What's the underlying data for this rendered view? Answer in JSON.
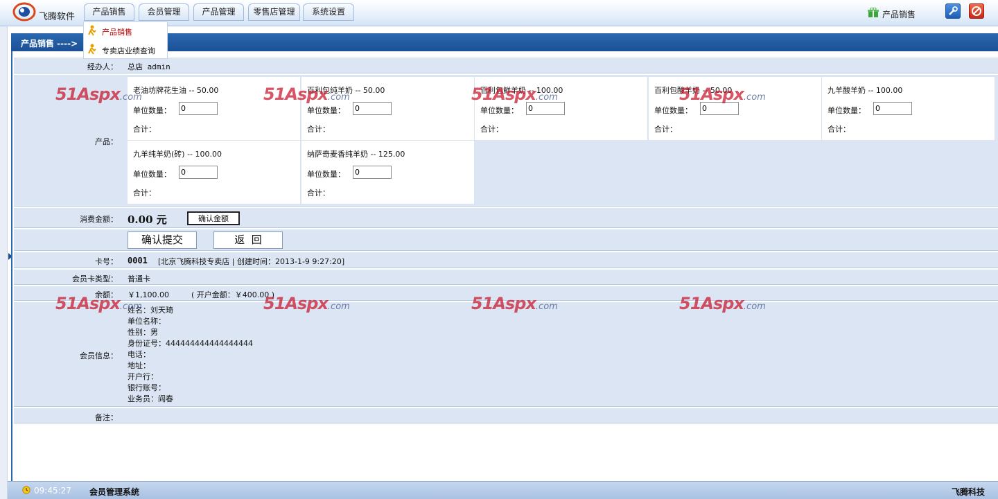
{
  "header": {
    "brand": "飞腾软件",
    "nav": [
      "产品销售",
      "会员管理",
      "产品管理",
      "零售店管理",
      "系统设置"
    ],
    "right_label": "产品销售"
  },
  "dropdown": {
    "items": [
      "产品销售",
      "专卖店业绩查询"
    ]
  },
  "title": "产品销售 ---->",
  "form": {
    "operator_label": "经办人：",
    "operator_value": "总店 admin",
    "product_label": "产品：",
    "qty_label": "单位数量：",
    "sum_label": "合计：",
    "products": [
      {
        "name": "老油坊牌花生油 -- 50.00",
        "qty": "0"
      },
      {
        "name": "百利包纯羊奶 -- 50.00",
        "qty": "0"
      },
      {
        "name": "百利包鲜羊奶 -- 100.00",
        "qty": "0"
      },
      {
        "name": "百利包酸羊奶 -- 50.00",
        "qty": "0"
      },
      {
        "name": "九羊酸羊奶 -- 100.00",
        "qty": "0"
      },
      {
        "name": "九羊纯羊奶(砖) -- 100.00",
        "qty": "0"
      },
      {
        "name": "纳萨奇麦香纯羊奶 -- 125.00",
        "qty": "0"
      }
    ],
    "amount_label": "消费金额：",
    "amount_value": "0.00 元",
    "confirm_amount_button": "确认金额",
    "submit_button": "确认提交",
    "back_button": "返  回",
    "card_label": "卡号：",
    "card_no": "0001",
    "card_info": "[北京飞腾科技专卖店 | 创建时间：2013-1-9 9:27:20]",
    "card_type_label": "会员卡类型：",
    "card_type": "普通卡",
    "balance_label": "余额：",
    "balance": "￥1,100.00",
    "opening_amount": "( 开户金额：￥400.00 )",
    "member_label": "会员信息：",
    "member_lines": [
      "姓名：刘天琦",
      "单位名称：",
      "性别：男",
      "身份证号：444444444444444444",
      "电话：",
      "地址：",
      "开户行：",
      "银行账号：",
      "业务员：阎春"
    ],
    "remark_label": "备注："
  },
  "watermark": {
    "main": "51Aspx",
    "suffix": ".com"
  },
  "status": {
    "time": "09:45:27",
    "system": "会员管理系统",
    "company": "飞腾科技"
  },
  "colors": {
    "title_bar": "#1c5096",
    "row_bg": "#dbe5f3",
    "watermark": "#c81428"
  }
}
